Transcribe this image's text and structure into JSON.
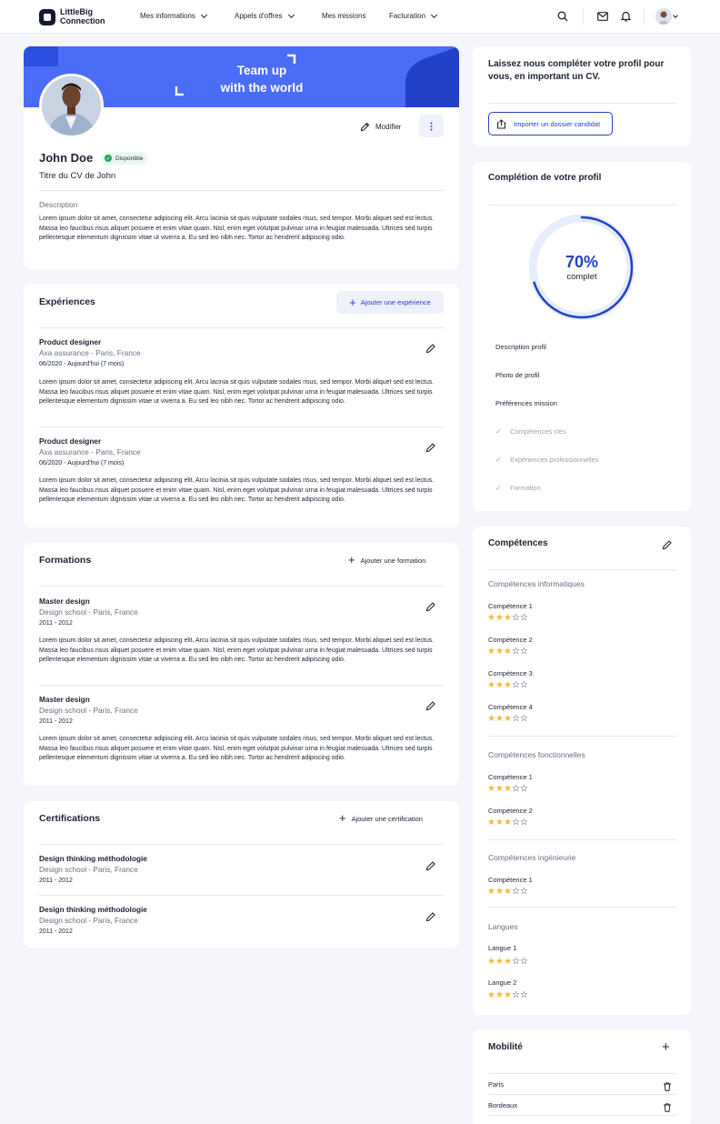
{
  "nav": {
    "logo": "LittleBig Connection",
    "menu": [
      "Mes informations",
      "Appels d'offres",
      "Mes missions",
      "Facturation"
    ]
  },
  "profile": {
    "banner_line1": "Team up",
    "banner_line2": "with the world",
    "edit_label": "Modifier",
    "name": "John Doe",
    "status": "Disponible",
    "cv_title": "Titre du CV de John",
    "description_label": "Description",
    "description": "Lorem ipsum dolor sit amet, consectetur adipiscing elit. Arcu lacinia sit quis vulputate sodales risus, sed tempor. Morbi aliquet sed est lectus. Massa leo faucibus risus aliquet posuere et enim vitae quam. Nisl, enim eget volutpat pulvinar urna in feugiat malesuada. Ultrices sed turpis pellentesque elementum dignissim vitae ut viverra a. Eu sed leo nibh nec. Tortor ac hendrerit adipiscing odio."
  },
  "experiences": {
    "title": "Expériences",
    "add_label": "Ajouter une expérience",
    "items": [
      {
        "title": "Product designer",
        "sub": "Axa assurance - Paris, France",
        "date": "06/2020  - Aujourd'hui (7 mois)",
        "text": "Lorem ipsum dolor sit amet, consectetur adipiscing elit. Arcu lacinia sit quis vulputate sodales risus, sed tempor. Morbi aliquet sed est lectus. Massa leo faucibus risus aliquet posuere et enim vitae quam. Nisl, enim eget volutpat pulvinar urna in feugiat malesuada. Ultrices sed turpis pellentesque elementum dignissim vitae ut viverra a. Eu sed leo nibh nec. Tortor ac hendrerit adipiscing odio."
      },
      {
        "title": "Product designer",
        "sub": "Axa assurance - Paris, France",
        "date": "06/2020  - Aujourd'hui (7 mois)",
        "text": "Lorem ipsum dolor sit amet, consectetur adipiscing elit. Arcu lacinia sit quis vulputate sodales risus, sed tempor. Morbi aliquet sed est lectus. Massa leo faucibus risus aliquet posuere et enim vitae quam. Nisl, enim eget volutpat pulvinar urna in feugiat malesuada. Ultrices sed turpis pellentesque elementum dignissim vitae ut viverra a. Eu sed leo nibh nec. Tortor ac hendrerit adipiscing odio."
      }
    ]
  },
  "formations": {
    "title": "Formations",
    "add_label": "Ajouter une formation",
    "items": [
      {
        "title": "Master design",
        "sub": "Design school - Paris, France",
        "date": "2011 - 2012",
        "text": "Lorem ipsum dolor sit amet, consectetur adipiscing elit. Arcu lacinia sit quis vulputate sodales risus, sed tempor. Morbi aliquet sed est lectus. Massa leo faucibus risus aliquet posuere et enim vitae quam. Nisl, enim eget volutpat pulvinar urna in feugiat malesuada. Ultrices sed turpis pellentesque elementum dignissim vitae ut viverra a. Eu sed leo nibh nec. Tortor ac hendrerit adipiscing odio."
      },
      {
        "title": "Master design",
        "sub": "Design school - Paris, France",
        "date": "2011 - 2012",
        "text": "Lorem ipsum dolor sit amet, consectetur adipiscing elit. Arcu lacinia sit quis vulputate sodales risus, sed tempor. Morbi aliquet sed est lectus. Massa leo faucibus risus aliquet posuere et enim vitae quam. Nisl, enim eget volutpat pulvinar urna in feugiat malesuada. Ultrices sed turpis pellentesque elementum dignissim vitae ut viverra a. Eu sed leo nibh nec. Tortor ac hendrerit adipiscing odio."
      }
    ]
  },
  "certifications": {
    "title": "Certifications",
    "add_label": "Ajouter une certification",
    "items": [
      {
        "title": "Design thinking méthodologie",
        "sub": "Design school - Paris, France",
        "date": "2011 - 2012"
      },
      {
        "title": "Design thinking méthodologie",
        "sub": "Design school - Paris, France",
        "date": "2011 - 2012"
      }
    ]
  },
  "import": {
    "title": "Laissez nous compléter votre profil pour vous, en important un CV.",
    "button": "Importer un dossier candidat"
  },
  "completion": {
    "title": "Complétion de votre profil",
    "percent_label": "70%",
    "percent_value": 70,
    "sub": "complet",
    "items": [
      {
        "label": "Description profil",
        "done": true
      },
      {
        "label": "Photo de profil",
        "done": true
      },
      {
        "label": "Préférences mission",
        "done": true
      },
      {
        "label": "Compétences clés",
        "done": false
      },
      {
        "label": "Expériences professionnelles",
        "done": false
      },
      {
        "label": "Formation",
        "done": false
      }
    ]
  },
  "skills": {
    "title": "Compétences",
    "groups": [
      {
        "label": "Compétences informatiques",
        "items": [
          {
            "name": "Compétence 1",
            "rating": 3
          },
          {
            "name": "Compétence 2",
            "rating": 3
          },
          {
            "name": "Compétence 3",
            "rating": 3
          },
          {
            "name": "Compétence 4",
            "rating": 3
          }
        ]
      },
      {
        "label": "Compétences fonctionnelles",
        "items": [
          {
            "name": "Compétence 1",
            "rating": 3
          },
          {
            "name": "Compétence 2",
            "rating": 3
          }
        ]
      },
      {
        "label": "Compétences ingénieurie",
        "items": [
          {
            "name": "Compétence 1",
            "rating": 3
          }
        ]
      },
      {
        "label": "Langues",
        "items": [
          {
            "name": "Langue 1",
            "rating": 3
          },
          {
            "name": "Langue 2",
            "rating": 3
          }
        ]
      }
    ]
  },
  "mobility": {
    "title": "Mobilité",
    "items": [
      "Paris",
      "Bordeaux"
    ]
  },
  "colors": {
    "accent": "#2340c8",
    "banner": "#4a6cf7",
    "star": "#f4b73d",
    "available": "#1ea55b"
  }
}
